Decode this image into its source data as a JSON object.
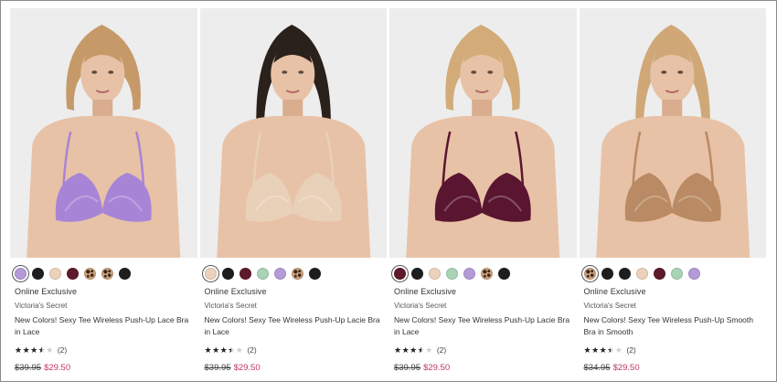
{
  "products": [
    {
      "exclusive": "Online Exclusive",
      "brand": "Victoria's Secret",
      "name": "New Colors! Sexy Tee Wireless Push-Up Lace Bra in Lace",
      "rating": 3.5,
      "review_count": "(2)",
      "was_price": "$39.95",
      "sale_price": "$29.50",
      "bra_color": "#a884d6",
      "hair_color": "#c69a68",
      "selected_swatch": 0,
      "swatches": [
        {
          "name": "lavender",
          "color": "#b49ad8"
        },
        {
          "name": "black",
          "color": "#1e1e1e"
        },
        {
          "name": "nude",
          "color": "#edd2bb"
        },
        {
          "name": "wine",
          "color": "#5e1a2b"
        },
        {
          "name": "leopard",
          "color": "leopard"
        },
        {
          "name": "leopard-2",
          "color": "leopard"
        },
        {
          "name": "black-2",
          "color": "#1e1e1e"
        }
      ]
    },
    {
      "exclusive": "Online Exclusive",
      "brand": "Victoria's Secret",
      "name": "New Colors! Sexy Tee Wireless Push-Up Lacie Bra in Lace",
      "rating": 3.5,
      "review_count": "(2)",
      "was_price": "$39.95",
      "sale_price": "$29.50",
      "bra_color": "#e9d0b8",
      "hair_color": "#2b211b",
      "selected_swatch": 0,
      "swatches": [
        {
          "name": "nude",
          "color": "#edd2bb"
        },
        {
          "name": "black",
          "color": "#1e1e1e"
        },
        {
          "name": "wine",
          "color": "#5e1a2b"
        },
        {
          "name": "sage",
          "color": "#a8d3b5"
        },
        {
          "name": "lavender",
          "color": "#b49ad8"
        },
        {
          "name": "leopard",
          "color": "leopard"
        },
        {
          "name": "black-2",
          "color": "#1e1e1e"
        }
      ]
    },
    {
      "exclusive": "Online Exclusive",
      "brand": "Victoria's Secret",
      "name": "New Colors! Sexy Tee Wireless Push-Up Lacie Bra in Lace",
      "rating": 3.5,
      "review_count": "(2)",
      "was_price": "$39.95",
      "sale_price": "$29.50",
      "bra_color": "#5a1530",
      "hair_color": "#d2ab78",
      "selected_swatch": 0,
      "swatches": [
        {
          "name": "wine",
          "color": "#5e1a2b"
        },
        {
          "name": "black",
          "color": "#1e1e1e"
        },
        {
          "name": "nude",
          "color": "#edd2bb"
        },
        {
          "name": "sage",
          "color": "#a8d3b5"
        },
        {
          "name": "lavender",
          "color": "#b49ad8"
        },
        {
          "name": "leopard",
          "color": "leopard"
        },
        {
          "name": "black-2",
          "color": "#1e1e1e"
        }
      ]
    },
    {
      "exclusive": "Online Exclusive",
      "brand": "Victoria's Secret",
      "name": "New Colors! Sexy Tee Wireless Push-Up Smooth Bra in Smooth",
      "rating": 3.5,
      "review_count": "(2)",
      "was_price": "$34.95",
      "sale_price": "$29.50",
      "bra_color": "#b98a63",
      "hair_color": "#d0a878",
      "selected_swatch": 0,
      "swatches": [
        {
          "name": "leopard",
          "color": "leopard"
        },
        {
          "name": "black",
          "color": "#1e1e1e"
        },
        {
          "name": "black-2",
          "color": "#1e1e1e"
        },
        {
          "name": "nude",
          "color": "#edd2bb"
        },
        {
          "name": "wine",
          "color": "#5e1a2b"
        },
        {
          "name": "sage",
          "color": "#a8d3b5"
        },
        {
          "name": "lavender",
          "color": "#b49ad8"
        }
      ]
    }
  ]
}
